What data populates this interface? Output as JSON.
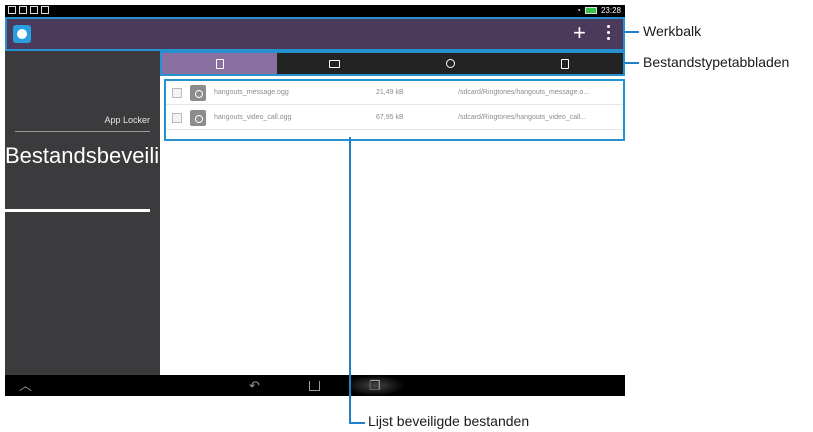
{
  "callouts": {
    "toolbar": "Werkbalk",
    "tabs": "Bestandstypetabbladen",
    "list": "Lijst beveiligde bestanden"
  },
  "statusbar": {
    "time": "23:28"
  },
  "sidebar": {
    "app_locker": "App Locker",
    "title": "Bestandsbeveiliging"
  },
  "toolbar": {
    "add_icon": "plus-icon",
    "overflow_icon": "kebab-menu-icon"
  },
  "tabs": [
    {
      "name": "documents",
      "icon": "document-icon",
      "active": true
    },
    {
      "name": "images",
      "icon": "image-icon",
      "active": false
    },
    {
      "name": "audio",
      "icon": "music-icon",
      "active": false
    },
    {
      "name": "other",
      "icon": "file-icon",
      "active": false
    }
  ],
  "files": [
    {
      "name": "hangouts_message.ogg",
      "size": "21,49 kB",
      "path": "/sdcard/Ringtones/hangouts_message.o..."
    },
    {
      "name": "hangouts_video_call.ogg",
      "size": "67,95 kB",
      "path": "/sdcard/Ringtones/hangouts_video_call..."
    }
  ],
  "colors": {
    "accent": "#2790cf",
    "toolbar": "#4b3a5c",
    "sidebar": "#3b3a3c",
    "active_tab": "#8a6fa1"
  }
}
